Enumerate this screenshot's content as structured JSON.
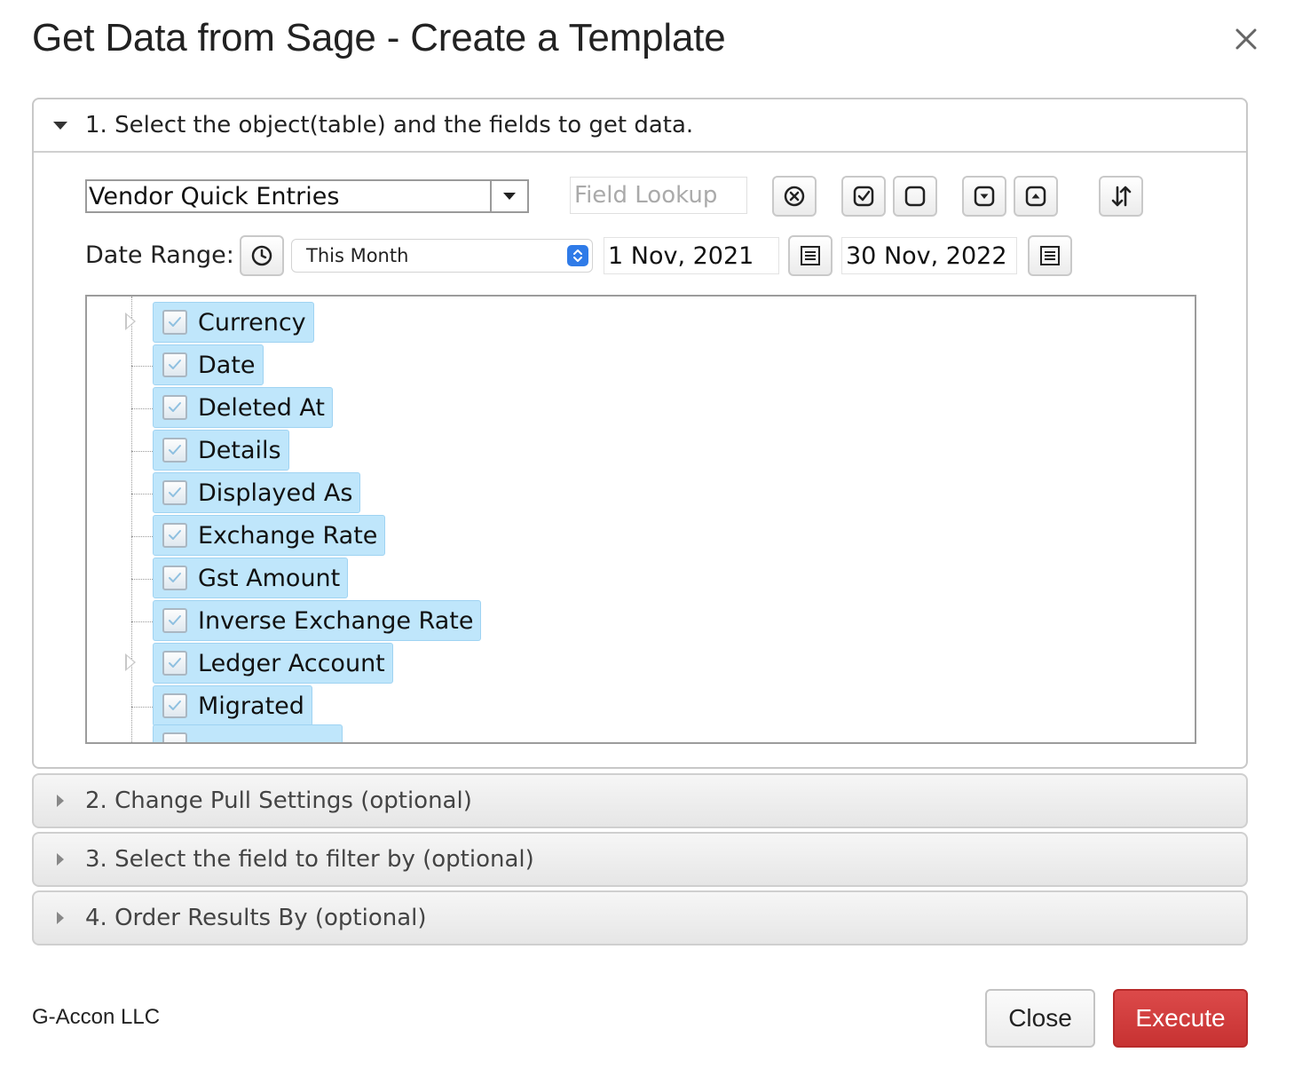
{
  "dialog": {
    "title": "Get Data from Sage - Create a Template"
  },
  "sections": {
    "s1": {
      "label": "1. Select the object(table) and the fields to get data."
    },
    "s2": {
      "label": "2. Change Pull Settings (optional)"
    },
    "s3": {
      "label": "3. Select the field to filter by (optional)"
    },
    "s4": {
      "label": "4. Order Results By (optional)"
    }
  },
  "toolbar": {
    "object_value": "Vendor Quick Entries",
    "field_lookup_placeholder": "Field Lookup"
  },
  "date_range": {
    "label": "Date Range:",
    "preset": "This Month",
    "start": "1 Nov, 2021",
    "end": "30 Nov, 2022"
  },
  "tree": {
    "items": [
      {
        "label": "Currency",
        "has_children": true
      },
      {
        "label": "Date",
        "has_children": false
      },
      {
        "label": "Deleted At",
        "has_children": false
      },
      {
        "label": "Details",
        "has_children": false
      },
      {
        "label": "Displayed As",
        "has_children": false
      },
      {
        "label": "Exchange Rate",
        "has_children": false
      },
      {
        "label": "Gst Amount",
        "has_children": false
      },
      {
        "label": "Inverse Exchange Rate",
        "has_children": false
      },
      {
        "label": "Ledger Account",
        "has_children": true
      },
      {
        "label": "Migrated",
        "has_children": false
      }
    ]
  },
  "footer": {
    "brand": "G-Accon LLC",
    "close_label": "Close",
    "execute_label": "Execute"
  },
  "colors": {
    "accent_blue": "#2f7be8",
    "selection_fill": "#bfe6fb",
    "execute_red": "#d03c3c"
  }
}
